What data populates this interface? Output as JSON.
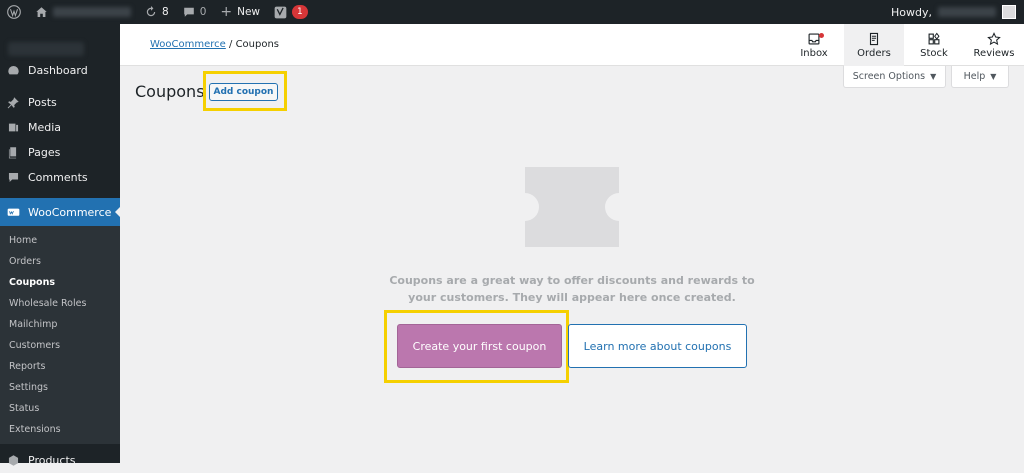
{
  "admin_bar": {
    "updates_count": "8",
    "comments_count": "0",
    "new_label": "New",
    "yoast_badge": "1",
    "howdy": "Howdy,"
  },
  "sidebar": {
    "items": [
      {
        "label": "Dashboard",
        "icon": "dashboard-icon"
      },
      {
        "label": "Posts",
        "icon": "pin-icon"
      },
      {
        "label": "Media",
        "icon": "media-icon"
      },
      {
        "label": "Pages",
        "icon": "pages-icon"
      },
      {
        "label": "Comments",
        "icon": "comment-icon"
      }
    ],
    "woocommerce": "WooCommerce",
    "submenu": [
      "Home",
      "Orders",
      "Coupons",
      "Wholesale Roles",
      "Mailchimp",
      "Customers",
      "Reports",
      "Settings",
      "Status",
      "Extensions"
    ],
    "current_sub": "Coupons",
    "products": "Products"
  },
  "header": {
    "breadcrumb_link": "WooCommerce",
    "breadcrumb_sep": " / ",
    "breadcrumb_current": "Coupons",
    "buttons": {
      "inbox": "Inbox",
      "orders": "Orders",
      "stock": "Stock",
      "reviews": "Reviews"
    }
  },
  "tabs": {
    "screen_options": "Screen Options",
    "help": "Help"
  },
  "page": {
    "title": "Coupons",
    "add_button": "Add coupon",
    "message": "Coupons are a great way to offer discounts and rewards to your customers. They will appear here once created.",
    "primary_button": "Create your first coupon",
    "secondary_button": "Learn more about coupons"
  },
  "colors": {
    "accent": "#2271b1",
    "woo_purple": "#bb77ae",
    "highlight": "#f5d000",
    "admin_dark": "#1d2327"
  }
}
